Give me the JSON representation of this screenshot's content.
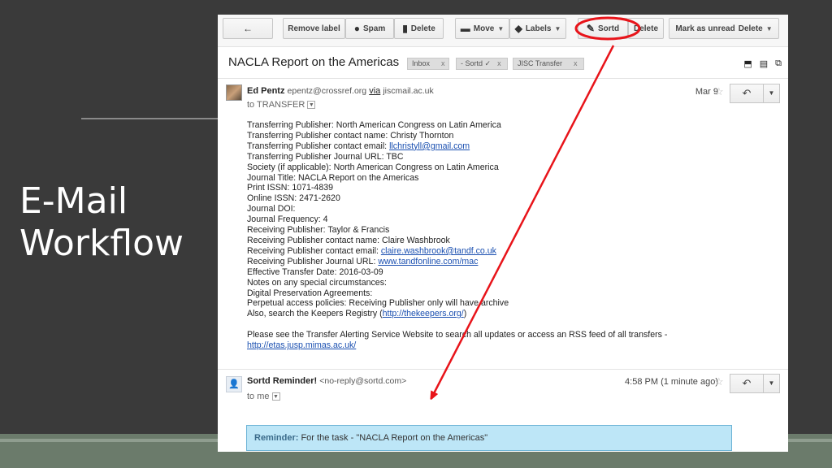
{
  "slide": {
    "title_line1": "E-Mail",
    "title_line2": "Workflow"
  },
  "toolbar": {
    "back_icon": "←",
    "remove_label": "Remove label",
    "spam": "Spam",
    "delete": "Delete",
    "move": "Move",
    "labels": "Labels",
    "sortd": "Sortd",
    "delete2": "Delete",
    "mark_unread": "Mark as unread",
    "delete3": "Delete"
  },
  "thread": {
    "subject": "NACLA Report on the Americas",
    "tags": [
      {
        "label": "Inbox",
        "close": "x"
      },
      {
        "label": "- Sortd ✓",
        "close": "x"
      },
      {
        "label": "JISC Transfer",
        "close": "x"
      }
    ]
  },
  "message1": {
    "sender_name": "Ed Pentz",
    "sender_email": "epentz@crossref.org",
    "via": "via",
    "via_domain": "jiscmail.ac.uk",
    "to": "to TRANSFER",
    "date": "Mar 9",
    "body": {
      "l1": "Transferring Publisher: North American Congress on Latin America",
      "l2": "Transferring Publisher contact name: Christy Thornton",
      "l3_label": "Transferring Publisher contact email: ",
      "l3_link": "llchristyll@gmail.com",
      "l4": "Transferring Publisher Journal URL: TBC",
      "l5": "Society (if applicable): North American Congress on Latin America",
      "l6": "Journal Title: NACLA Report on the Americas",
      "l7": "Print ISSN: 1071-4839",
      "l8": "Online ISSN: 2471-2620",
      "l9": "Journal DOI:",
      "l10": "Journal Frequency: 4",
      "l11": "Receiving Publisher: Taylor & Francis",
      "l12": "Receiving Publisher contact name: Claire Washbrook",
      "l13_label": "Receiving Publisher contact email: ",
      "l13_link": "claire.washbrook@tandf.co.uk",
      "l14_label": "Receiving Publisher Journal URL: ",
      "l14_link": "www.tandfonline.com/mac",
      "l15": "Effective Transfer Date: 2016-03-09",
      "l16": "Notes on any special circumstances:",
      "l17": "Digital Preservation Agreements:",
      "l18": "Perpetual access policies: Receiving Publisher only will have archive",
      "l19_label": "Also, search the Keepers Registry (",
      "l19_link": "http://thekeepers.org/",
      "l19_end": ")",
      "l20": "Please see the Transfer Alerting Service Website to search all updates or access an RSS feed of all transfers -",
      "l21_link": "http://etas.jusp.mimas.ac.uk/"
    }
  },
  "message2": {
    "sender_name": "Sortd Reminder!",
    "sender_email": "<no-reply@sortd.com>",
    "to": "to me",
    "date": "4:58 PM (1 minute ago)",
    "reminder_label": "Reminder:",
    "reminder_text": " For the task - \"NACLA Report on the Americas\""
  },
  "colors": {
    "annotation": "#e8141a",
    "reminder_bg": "#bde6f7"
  }
}
